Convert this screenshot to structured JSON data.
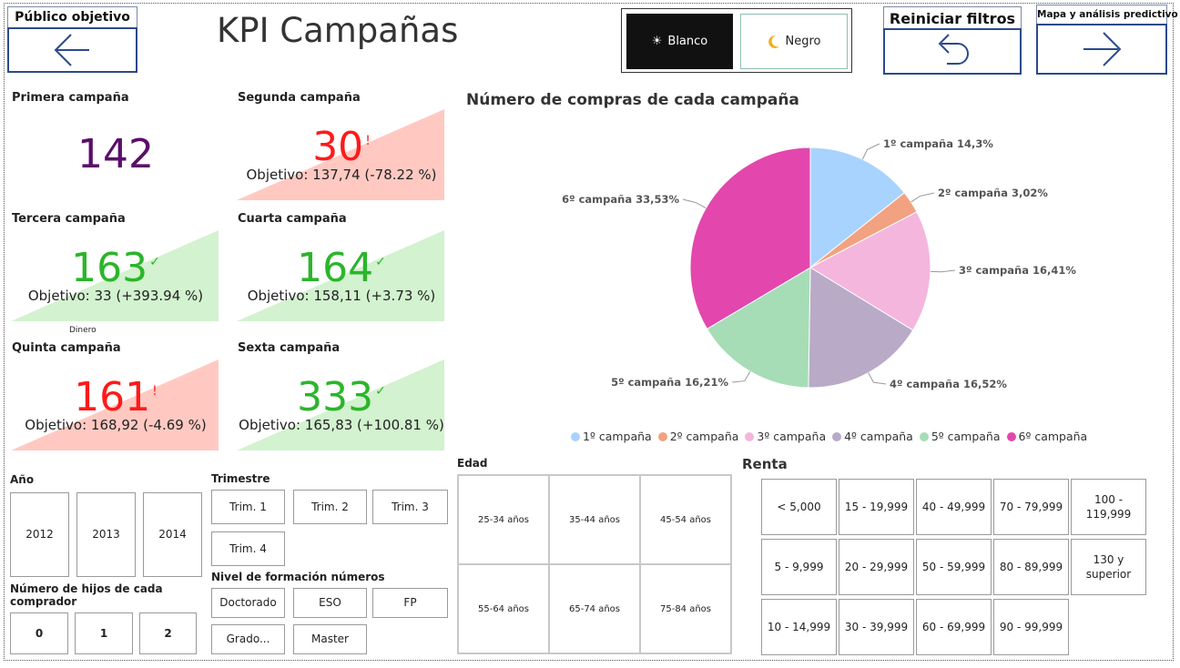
{
  "nav": {
    "back_label": "Público objetivo",
    "reset_label": "Reiniciar filtros",
    "forward_label": "Mapa y análisis predictivo"
  },
  "title": "KPI Campañas",
  "theme": {
    "light_label": "Blanco",
    "dark_label": "Negro",
    "light_icon": "sun-icon",
    "dark_icon": "moon-icon"
  },
  "kpis": [
    {
      "title": "Primera campaña",
      "value": "142",
      "goal": "",
      "status": "none",
      "color": "#5b0e6b"
    },
    {
      "title": "Segunda campaña",
      "value": "30",
      "goal": "Objetivo: 137,74 (-78.22 %)",
      "status": "bad",
      "mark": "!",
      "color": "#ff1a1a"
    },
    {
      "title": "Tercera campaña",
      "value": "163",
      "goal": "Objetivo: 33 (+393.94 %)",
      "status": "good",
      "mark": "✓",
      "color": "#2bb52b"
    },
    {
      "title": "Cuarta campaña",
      "value": "164",
      "goal": "Objetivo: 158,11 (+3.73 %)",
      "status": "good",
      "mark": "✓",
      "color": "#2bb52b"
    },
    {
      "title": "Quinta campaña",
      "value": "161",
      "goal": "Objetivo: 168,92 (-4.69 %)",
      "status": "bad",
      "mark": "!",
      "color": "#ff1a1a"
    },
    {
      "title": "Sexta campaña",
      "value": "333",
      "goal": "Objetivo: 165,83 (+100.81 %)",
      "status": "good",
      "mark": "✓",
      "color": "#2bb52b"
    }
  ],
  "dinero_label": "Dinero",
  "colors": {
    "bad_bg": "#ffc9c2",
    "good_bg": "#d3f2cf",
    "nav_border": "#2b4a8b"
  },
  "chart_data": {
    "type": "pie",
    "title": "Número de compras de cada campaña",
    "categories": [
      "1º campaña",
      "2º campaña",
      "3º campaña",
      "4º campaña",
      "5º campaña",
      "6º campaña"
    ],
    "values": [
      14.3,
      3.02,
      16.41,
      16.52,
      16.21,
      33.53
    ],
    "labels": [
      "1º campaña 14,3%",
      "2º campaña 3,02%",
      "3º campaña 16,41%",
      "4º campaña 16,52%",
      "5º campaña 16,21%",
      "6º campaña 33,53%"
    ],
    "colors": [
      "#a9d3ff",
      "#f2a280",
      "#f4b6dd",
      "#b9aac8",
      "#a6ddb6",
      "#e347ad"
    ],
    "legend": "bottom"
  },
  "slicers": {
    "anio": {
      "title": "Año",
      "options": [
        "2012",
        "2013",
        "2014"
      ]
    },
    "trimestre": {
      "title": "Trimestre",
      "options": [
        "Trim. 1",
        "Trim. 2",
        "Trim. 3",
        "Trim. 4"
      ]
    },
    "hijos": {
      "title": "Número de hijos de cada comprador",
      "options": [
        "0",
        "1",
        "2"
      ]
    },
    "formacion": {
      "title": "Nivel de formación números",
      "options": [
        "Doctorado",
        "ESO",
        "FP",
        "Grado...",
        "Master"
      ]
    },
    "edad": {
      "title": "Edad",
      "options": [
        "25-34 años",
        "35-44 años",
        "45-54 años",
        "55-64 años",
        "65-74 años",
        "75-84 años"
      ]
    },
    "renta": {
      "title": "Renta",
      "options": [
        "< 5,000",
        "15 - 19,999",
        "40 - 49,999",
        "70 - 79,999",
        "100 - 119,999",
        "5 - 9,999",
        "20 - 29,999",
        "50 - 59,999",
        "80 - 89,999",
        "130 y superior",
        "10 - 14,999",
        "30 - 39,999",
        "60 - 69,999",
        "90 - 99,999"
      ]
    }
  }
}
